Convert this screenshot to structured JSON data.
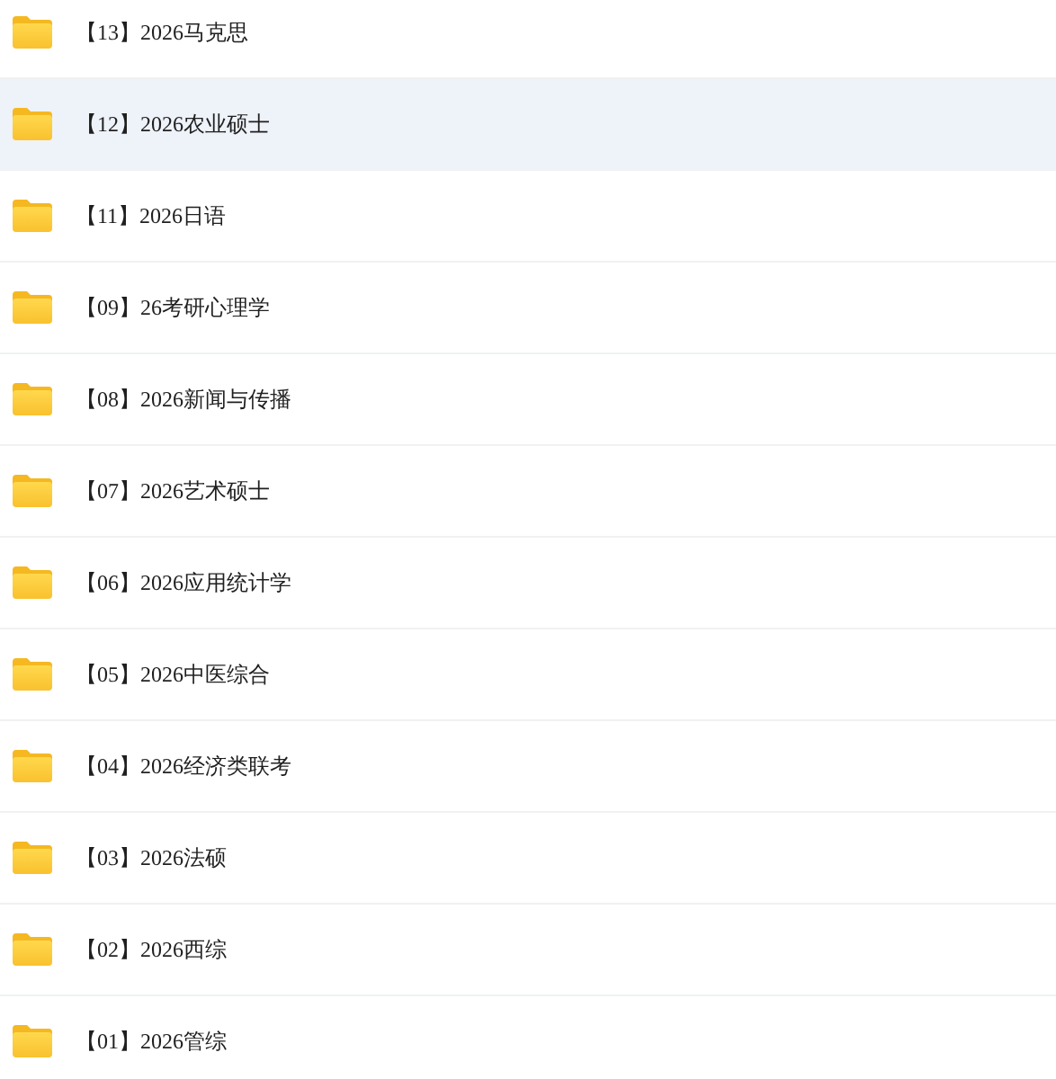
{
  "folders": [
    {
      "name": "【13】2026马克思",
      "selected": false
    },
    {
      "name": "【12】2026农业硕士",
      "selected": true
    },
    {
      "name": "【11】2026日语",
      "selected": false
    },
    {
      "name": "【09】26考研心理学",
      "selected": false
    },
    {
      "name": "【08】2026新闻与传播",
      "selected": false
    },
    {
      "name": "【07】2026艺术硕士",
      "selected": false
    },
    {
      "name": "【06】2026应用统计学",
      "selected": false
    },
    {
      "name": "【05】2026中医综合",
      "selected": false
    },
    {
      "name": "【04】2026经济类联考",
      "selected": false
    },
    {
      "name": "【03】2026法硕",
      "selected": false
    },
    {
      "name": "【02】2026西综",
      "selected": false
    },
    {
      "name": "【01】2026管综",
      "selected": false
    }
  ]
}
